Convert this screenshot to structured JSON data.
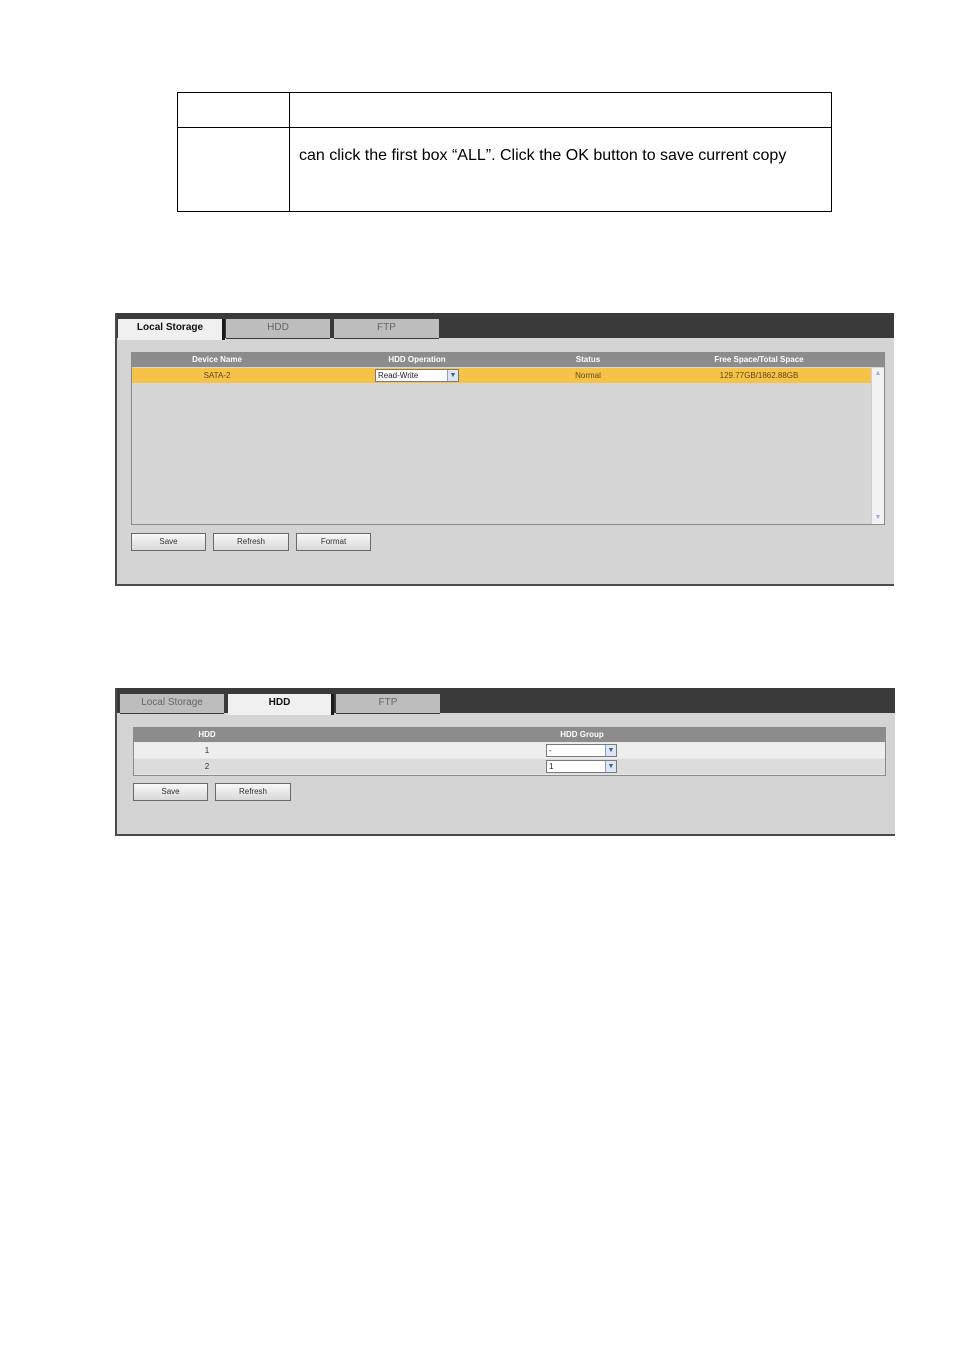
{
  "doc": {
    "cell_text": "can click the first box “ALL”. Click the OK button to save current copy"
  },
  "local_storage_panel": {
    "tabs": [
      {
        "label": "Local Storage",
        "active": true
      },
      {
        "label": "HDD",
        "active": false
      },
      {
        "label": "FTP",
        "active": false
      }
    ],
    "columns": [
      "Device Name",
      "HDD Operation",
      "Status",
      "Free Space/Total Space"
    ],
    "rows": [
      {
        "device": "SATA-2",
        "operation": "Read-Write",
        "status": "Normal",
        "space": "129.77GB/1862.88GB"
      }
    ],
    "buttons": {
      "save": "Save",
      "refresh": "Refresh",
      "format": "Format"
    }
  },
  "hdd_panel": {
    "tabs": [
      {
        "label": "Local Storage",
        "active": false
      },
      {
        "label": "HDD",
        "active": true
      },
      {
        "label": "FTP",
        "active": false
      }
    ],
    "columns": [
      "HDD",
      "HDD Group"
    ],
    "rows": [
      {
        "hdd": "1",
        "group": "-"
      },
      {
        "hdd": "2",
        "group": "1"
      }
    ],
    "buttons": {
      "save": "Save",
      "refresh": "Refresh"
    }
  },
  "colors": {
    "highlight_row": "#f6c247",
    "header_bar": "#3a3a3a",
    "panel_bg": "#d4d4d4"
  }
}
